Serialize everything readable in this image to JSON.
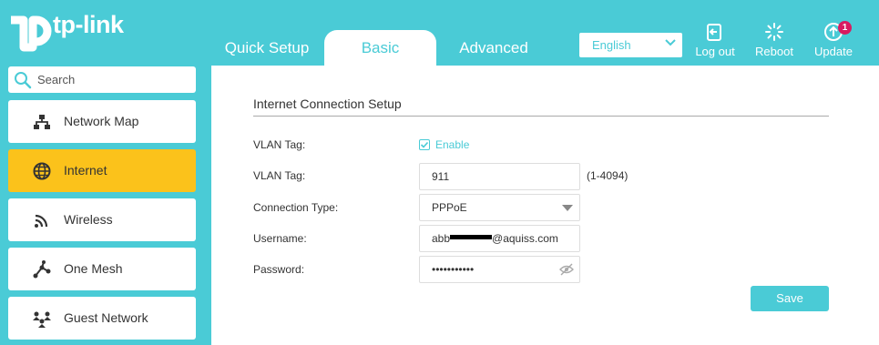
{
  "brand": {
    "name": "tp-link"
  },
  "header": {
    "tabs": [
      {
        "label": "Quick Setup"
      },
      {
        "label": "Basic"
      },
      {
        "label": "Advanced"
      }
    ],
    "language": "English",
    "logout_label": "Log out",
    "reboot_label": "Reboot",
    "update_label": "Update",
    "update_badge": "1"
  },
  "sidebar": {
    "search_placeholder": "Search",
    "items": [
      {
        "label": "Network Map",
        "icon": "network-map-icon"
      },
      {
        "label": "Internet",
        "icon": "globe-icon",
        "active": true
      },
      {
        "label": "Wireless",
        "icon": "wireless-icon"
      },
      {
        "label": "One Mesh",
        "icon": "mesh-icon"
      },
      {
        "label": "Guest Network",
        "icon": "guest-network-icon"
      }
    ]
  },
  "main": {
    "section_title": "Internet Connection Setup",
    "vlan_enable": {
      "label": "VLAN Tag:",
      "checkbox_label": "Enable",
      "checked": true
    },
    "vlan_tag": {
      "label": "VLAN Tag:",
      "value": "911",
      "hint": "(1-4094)"
    },
    "connection_type": {
      "label": "Connection Type:",
      "value": "PPPoE"
    },
    "username": {
      "label": "Username:",
      "value_prefix": "abb",
      "value_suffix": "@aquiss.com"
    },
    "password": {
      "label": "Password:",
      "value": "•••••••••••"
    },
    "save_label": "Save"
  },
  "colors": {
    "accent": "#4acbd6",
    "active_nav": "#fbc21b",
    "badge": "#d81b60"
  }
}
